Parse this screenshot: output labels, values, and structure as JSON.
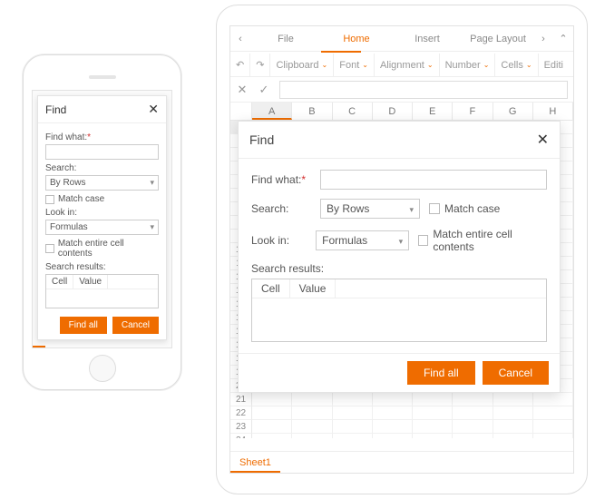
{
  "colors": {
    "accent": "#ef6c00"
  },
  "dialog": {
    "title": "Find",
    "find_what_label": "Find what:",
    "search_label": "Search:",
    "look_in_label": "Look in:",
    "search_value": "By Rows",
    "look_in_value": "Formulas",
    "match_case_label": "Match case",
    "match_entire_label": "Match entire cell contents",
    "results_label": "Search results:",
    "col_cell": "Cell",
    "col_value": "Value",
    "find_all": "Find all",
    "cancel": "Cancel",
    "close": "✕"
  },
  "tablet": {
    "tabs": {
      "file": "File",
      "home": "Home",
      "insert": "Insert",
      "page_layout": "Page Layout"
    },
    "toolbar": {
      "clipboard": "Clipboard",
      "font": "Font",
      "alignment": "Alignment",
      "number": "Number",
      "cells": "Cells",
      "editing": "Editi"
    },
    "columns": [
      "A",
      "B",
      "C",
      "D",
      "E",
      "F",
      "G",
      "H"
    ],
    "rows_visible": 26,
    "sheet_tab": "Sheet1"
  }
}
